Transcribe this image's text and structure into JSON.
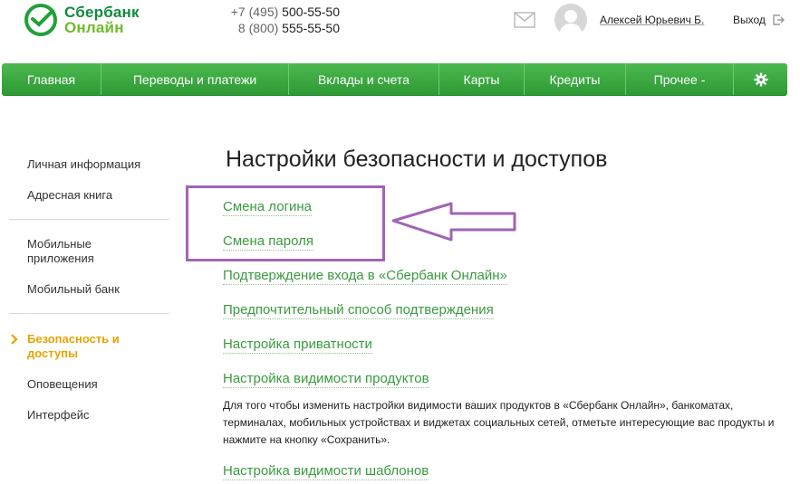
{
  "header": {
    "logo_line1": "Сбербанк",
    "logo_line2": "Онлайн",
    "phone1_prefix": "+7 (495) ",
    "phone1_number": "500-55-50",
    "phone2_prefix": "8 (800) ",
    "phone2_number": "555-55-50",
    "user_name": "Алексей Юрьевич Б.",
    "logout_label": "Выход"
  },
  "nav": {
    "items": [
      {
        "label": "Главная"
      },
      {
        "label": "Переводы и платежи"
      },
      {
        "label": "Вклады и счета"
      },
      {
        "label": "Карты"
      },
      {
        "label": "Кредиты"
      },
      {
        "label": "Прочее -"
      }
    ]
  },
  "sidebar": {
    "items": [
      {
        "label": "Личная информация"
      },
      {
        "label": "Адресная книга"
      },
      {
        "label": "Мобильные приложения"
      },
      {
        "label": "Мобильный банк"
      },
      {
        "label": "Безопасность и доступы"
      },
      {
        "label": "Оповещения"
      },
      {
        "label": "Интерфейс"
      }
    ]
  },
  "main": {
    "title": "Настройки безопасности и доступов",
    "links": [
      {
        "label": "Смена логина"
      },
      {
        "label": "Смена пароля"
      },
      {
        "label": "Подтверждение входа в «Сбербанк Онлайн»"
      },
      {
        "label": "Предпочтительный способ подтверждения"
      },
      {
        "label": "Настройка приватности"
      },
      {
        "label": "Настройка видимости продуктов"
      },
      {
        "label": "Настройка видимости шаблонов"
      }
    ],
    "help_text": "Для того чтобы изменить настройки видимости ваших продуктов в «Сбербанк Онлайн», банкоматах, терминалах, мобильных устройствах и виджетах социальных сетей, отметьте интересующие вас продукты и нажмите на кнопку «Сохранить»."
  },
  "colors": {
    "brand_green": "#108a3e",
    "nav_green": "#3aa83f",
    "link_green": "#3a9b3f",
    "active_orange": "#e6a400",
    "annotation_purple": "#a064b5"
  }
}
